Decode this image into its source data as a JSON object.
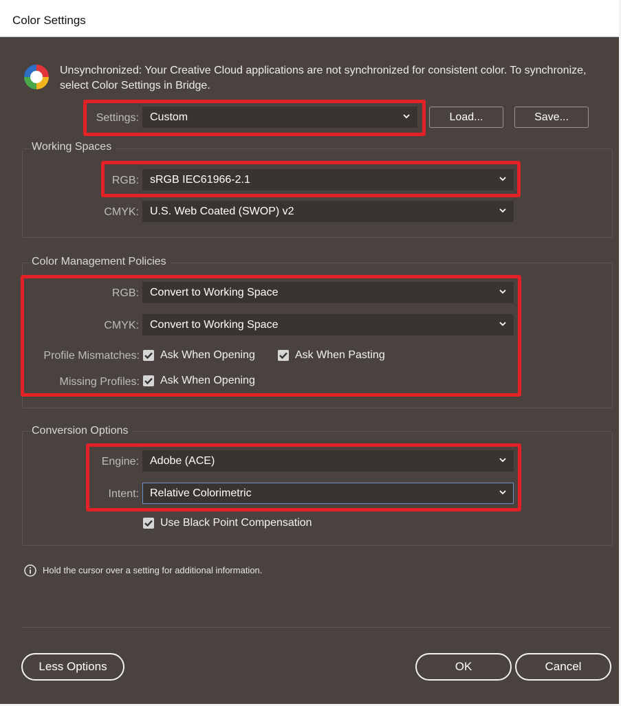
{
  "window": {
    "title": "Color Settings"
  },
  "sync": {
    "icon": "color-wheel-icon",
    "message": "Unsynchronized: Your Creative Cloud applications are not synchronized for consistent color. To synchronize, select Color Settings in Bridge."
  },
  "settings": {
    "label": "Settings:",
    "value": "Custom",
    "load_label": "Load...",
    "save_label": "Save..."
  },
  "working_spaces": {
    "legend": "Working Spaces",
    "rgb_label": "RGB:",
    "rgb_value": "sRGB IEC61966-2.1",
    "cmyk_label": "CMYK:",
    "cmyk_value": "U.S. Web Coated (SWOP) v2"
  },
  "policies": {
    "legend": "Color Management Policies",
    "rgb_label": "RGB:",
    "rgb_value": "Convert to Working Space",
    "cmyk_label": "CMYK:",
    "cmyk_value": "Convert to Working Space",
    "mismatch_label": "Profile Mismatches:",
    "ask_opening": "Ask When Opening",
    "ask_pasting": "Ask When Pasting",
    "missing_label": "Missing Profiles:",
    "missing_ask_opening": "Ask When Opening"
  },
  "conversion": {
    "legend": "Conversion Options",
    "engine_label": "Engine:",
    "engine_value": "Adobe (ACE)",
    "intent_label": "Intent:",
    "intent_value": "Relative Colorimetric",
    "bpc_label": "Use Black Point Compensation"
  },
  "info": {
    "icon": "info-icon",
    "text": "Hold the cursor over a setting for additional information."
  },
  "footer": {
    "less_options": "Less Options",
    "ok": "OK",
    "cancel": "Cancel"
  },
  "colors": {
    "panel": "#4a423f",
    "highlight": "#e32227",
    "field": "#3a3431"
  }
}
